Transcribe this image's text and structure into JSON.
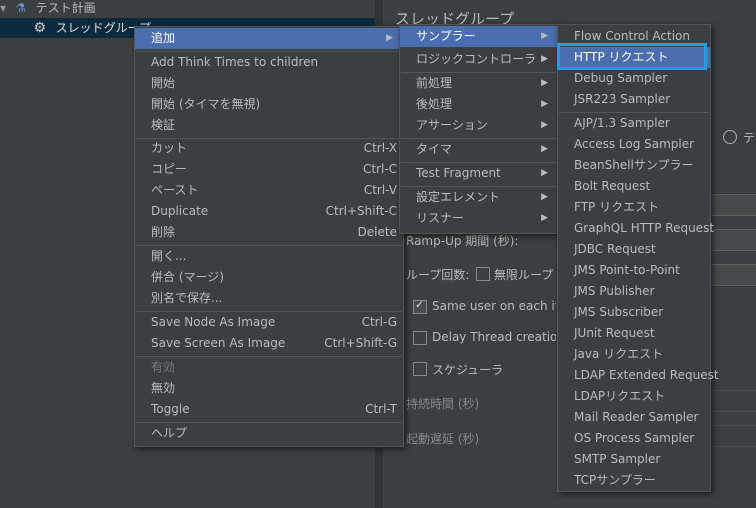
{
  "tree": {
    "items": [
      {
        "label": "テスト計画"
      },
      {
        "label": "スレッドグループ"
      }
    ]
  },
  "panel": {
    "title": "スレッドグループ",
    "radio_label": "テ",
    "ramp_up_label": "Ramp-Up 期間 (秒):",
    "loop_label": "ループ回数:",
    "infinite_label": "無限ループ",
    "same_user_label": "Same user on each iteration",
    "delay_thread_label": "Delay Thread creation until needed",
    "scheduler_label": "スケジューラ",
    "duration_label": "持続時間 (秒)",
    "startup_delay_label": "起動遅延 (秒)"
  },
  "context_menu": {
    "items": [
      {
        "label": "追加",
        "shortcut": "",
        "submenu": true,
        "highlighted": true
      },
      {
        "label": "Add Think Times to children"
      },
      {
        "label": "開始"
      },
      {
        "label": "開始 (タイマを無視)"
      },
      {
        "label": "検証"
      },
      {
        "label": "カット",
        "shortcut": "Ctrl-X"
      },
      {
        "label": "コピー",
        "shortcut": "Ctrl-C"
      },
      {
        "label": "ペースト",
        "shortcut": "Ctrl-V"
      },
      {
        "label": "Duplicate",
        "shortcut": "Ctrl+Shift-C"
      },
      {
        "label": "削除",
        "shortcut": "Delete"
      },
      {
        "label": "開く..."
      },
      {
        "label": "併合 (マージ)"
      },
      {
        "label": "別名で保存..."
      },
      {
        "label": "Save Node As Image",
        "shortcut": "Ctrl-G"
      },
      {
        "label": "Save Screen As Image",
        "shortcut": "Ctrl+Shift-G"
      },
      {
        "label": "有効",
        "disabled": true
      },
      {
        "label": "無効"
      },
      {
        "label": "Toggle",
        "shortcut": "Ctrl-T"
      },
      {
        "label": "ヘルプ"
      }
    ]
  },
  "add_submenu": {
    "items": [
      {
        "label": "サンプラー",
        "highlighted": true
      },
      {
        "label": "ロジックコントローラ"
      },
      {
        "label": "前処理"
      },
      {
        "label": "後処理"
      },
      {
        "label": "アサーション"
      },
      {
        "label": "タイマ"
      },
      {
        "label": "Test Fragment"
      },
      {
        "label": "設定エレメント"
      },
      {
        "label": "リスナー"
      }
    ]
  },
  "sampler_submenu": {
    "items": [
      {
        "label": "Flow Control Action"
      },
      {
        "label": "HTTP リクエスト",
        "highlighted": true
      },
      {
        "label": "Debug Sampler"
      },
      {
        "label": "JSR223 Sampler"
      },
      {
        "label": "AJP/1.3 Sampler"
      },
      {
        "label": "Access Log Sampler"
      },
      {
        "label": "BeanShellサンプラー"
      },
      {
        "label": "Bolt Request"
      },
      {
        "label": "FTP リクエスト"
      },
      {
        "label": "GraphQL HTTP Request"
      },
      {
        "label": "JDBC Request"
      },
      {
        "label": "JMS Point-to-Point"
      },
      {
        "label": "JMS Publisher"
      },
      {
        "label": "JMS Subscriber"
      },
      {
        "label": "JUnit Request"
      },
      {
        "label": "Java リクエスト"
      },
      {
        "label": "LDAP Extended Request"
      },
      {
        "label": "LDAPリクエスト"
      },
      {
        "label": "Mail Reader Sampler"
      },
      {
        "label": "OS Process Sampler"
      },
      {
        "label": "SMTP Sampler"
      },
      {
        "label": "TCPサンプラー"
      }
    ]
  },
  "colors": {
    "background": "#3c3f41",
    "menu_highlight": "#4b6eaf",
    "focus_outline": "#1ea0e0"
  }
}
